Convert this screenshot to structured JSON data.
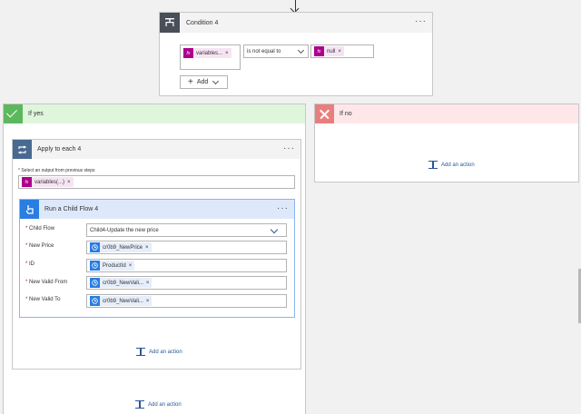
{
  "condition": {
    "title": "Condition 4",
    "left_token": "variables...",
    "operator": "is not equal to",
    "right_token": "null",
    "add_label": "Add"
  },
  "if_yes": {
    "label": "If yes",
    "add_action": "Add an action"
  },
  "if_no": {
    "label": "If no",
    "add_action": "Add an action"
  },
  "apply_each": {
    "title": "Apply to each 4",
    "select_label": "Select an output from previous steps",
    "select_token": "variables(...)",
    "add_action": "Add an action"
  },
  "child_flow": {
    "title": "Run a Child Flow 4",
    "fields": [
      {
        "label": "Child Flow",
        "value": "Child4-Update the new price"
      },
      {
        "label": "New Price",
        "token": "cr0b9_NewPrice"
      },
      {
        "label": "ID",
        "token": "ProductId"
      },
      {
        "label": "New Valid From",
        "token": "cr0b9_NewVali..."
      },
      {
        "label": "New Valid To",
        "token": "cr0b9_NewVali..."
      }
    ]
  },
  "colors": {
    "condition_header": "#484f58",
    "yes_bg": "#dff6dd",
    "yes_icon": "#5cb85c",
    "no_bg": "#fde7e9",
    "no_icon": "#e87f7f",
    "loop_icon": "#486991",
    "child_header": "#dde9fb",
    "child_icon": "#2a7de1",
    "fx_token": "#ad008c"
  }
}
